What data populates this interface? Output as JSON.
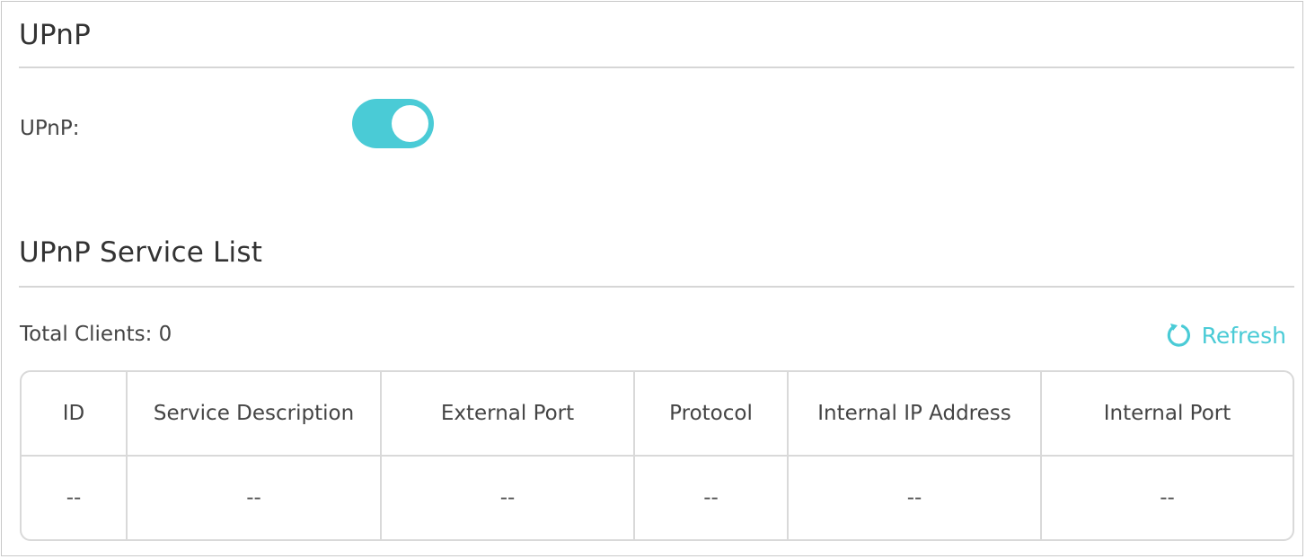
{
  "upnp_section": {
    "title": "UPnP",
    "upnp_label": "UPnP:",
    "toggle_state": "on"
  },
  "service_list": {
    "title": "UPnP Service List",
    "total_clients_label": "Total Clients: 0",
    "refresh_label": "Refresh",
    "columns": [
      "ID",
      "Service Description",
      "External Port",
      "Protocol",
      "Internal IP Address",
      "Internal Port"
    ],
    "rows": [
      [
        "--",
        "--",
        "--",
        "--",
        "--",
        "--"
      ]
    ]
  },
  "colors": {
    "accent": "#4acbd6",
    "border": "#d9d9d9",
    "text": "#333333"
  },
  "icons": {
    "refresh": "refresh-icon"
  }
}
